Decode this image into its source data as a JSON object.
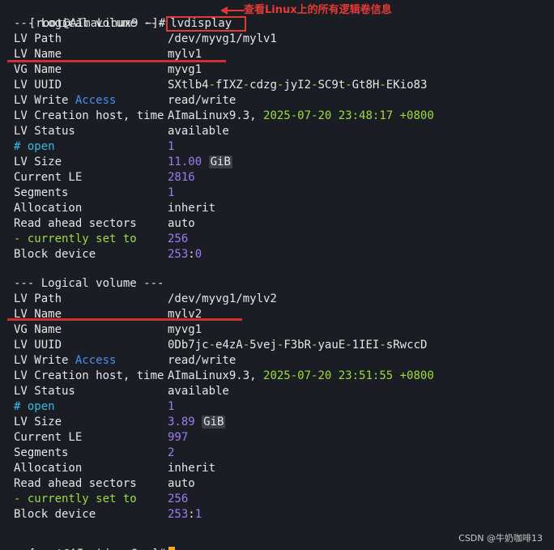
{
  "prompt": "[root@AImaLinux9 ~]#",
  "command": "lvdisplay",
  "annotation": "查看Linux上的所有逻辑卷信息",
  "watermark": "CSDN @牛奶咖啡13",
  "colors": {
    "annotation": "#e53935",
    "cursor": "#f5a623",
    "number": "#9d7cf0",
    "date": "#9ddc3c",
    "comment": "#38b9e8"
  },
  "volumes": [
    {
      "header": "--- Logical volume ---",
      "lv_path": {
        "label": "LV Path",
        "value": "/dev/myvg1/mylv1"
      },
      "lv_name": {
        "label": "LV Name",
        "value": "mylv1"
      },
      "vg_name": {
        "label": "VG Name",
        "value": "myvg1"
      },
      "lv_uuid": {
        "label": "LV UUID",
        "p1": "SXtlb4",
        "s1": "-",
        "p2": "fIXZ",
        "s2": "-",
        "p3": "cdzg",
        "s3": "-",
        "p4": "jyI2",
        "s4": "-",
        "p5": "SC9t",
        "s5": "-",
        "p6": "Gt8H",
        "s6": "-",
        "p7": "EKio83"
      },
      "lv_write": {
        "label1": "LV Write ",
        "label2": "Access",
        "value": "read/write"
      },
      "lv_creation": {
        "label": "LV Creation host, time",
        "host": "AImaLinux9.3, ",
        "date": "2025-07-20",
        "time": " 23:48:17 ",
        "tz": "+0800"
      },
      "lv_status": {
        "label": "LV Status",
        "value": "available"
      },
      "open": {
        "label": "# open",
        "value": "1"
      },
      "lv_size": {
        "label": "LV Size",
        "value": "11.00",
        "unit": "GiB"
      },
      "current_le": {
        "label": "Current LE",
        "value": "2816"
      },
      "segments": {
        "label": "Segments",
        "value": "1"
      },
      "allocation": {
        "label": "Allocation",
        "value": "inherit"
      },
      "read_ahead": {
        "label": "Read ahead sectors",
        "value": "auto"
      },
      "currently_set": {
        "label": "- currently set to",
        "value": "256"
      },
      "block_device": {
        "label": "Block device",
        "major": "253",
        "sep": ":",
        "minor": "0"
      }
    },
    {
      "header": "--- Logical volume ---",
      "lv_path": {
        "label": "LV Path",
        "value": "/dev/myvg1/mylv2"
      },
      "lv_name": {
        "label": "LV Name",
        "value": "mylv2"
      },
      "vg_name": {
        "label": "VG Name",
        "value": "myvg1"
      },
      "lv_uuid": {
        "label": "LV UUID",
        "p1": "0Db7jc",
        "s1": "-",
        "p2": "e4zA",
        "s2": "-",
        "p3": "5vej",
        "s3": "-",
        "p4": "F3bR",
        "s4": "-",
        "p5": "yauE",
        "s5": "-",
        "p6": "1IEI",
        "s6": "-",
        "p7": "sRwccD"
      },
      "lv_write": {
        "label1": "LV Write ",
        "label2": "Access",
        "value": "read/write"
      },
      "lv_creation": {
        "label": "LV Creation host, time",
        "host": "AImaLinux9.3, ",
        "date": "2025-07-20",
        "time": " 23:51:55 ",
        "tz": "+0800"
      },
      "lv_status": {
        "label": "LV Status",
        "value": "available"
      },
      "open": {
        "label": "# open",
        "value": "1"
      },
      "lv_size": {
        "label": "LV Size",
        "value": "3.89",
        "unit": "GiB"
      },
      "current_le": {
        "label": "Current LE",
        "value": "997"
      },
      "segments": {
        "label": "Segments",
        "value": "2"
      },
      "allocation": {
        "label": "Allocation",
        "value": "inherit"
      },
      "read_ahead": {
        "label": "Read ahead sectors",
        "value": "auto"
      },
      "currently_set": {
        "label": "- currently set to",
        "value": "256"
      },
      "block_device": {
        "label": "Block device",
        "major": "253",
        "sep": ":",
        "minor": "1"
      }
    }
  ]
}
